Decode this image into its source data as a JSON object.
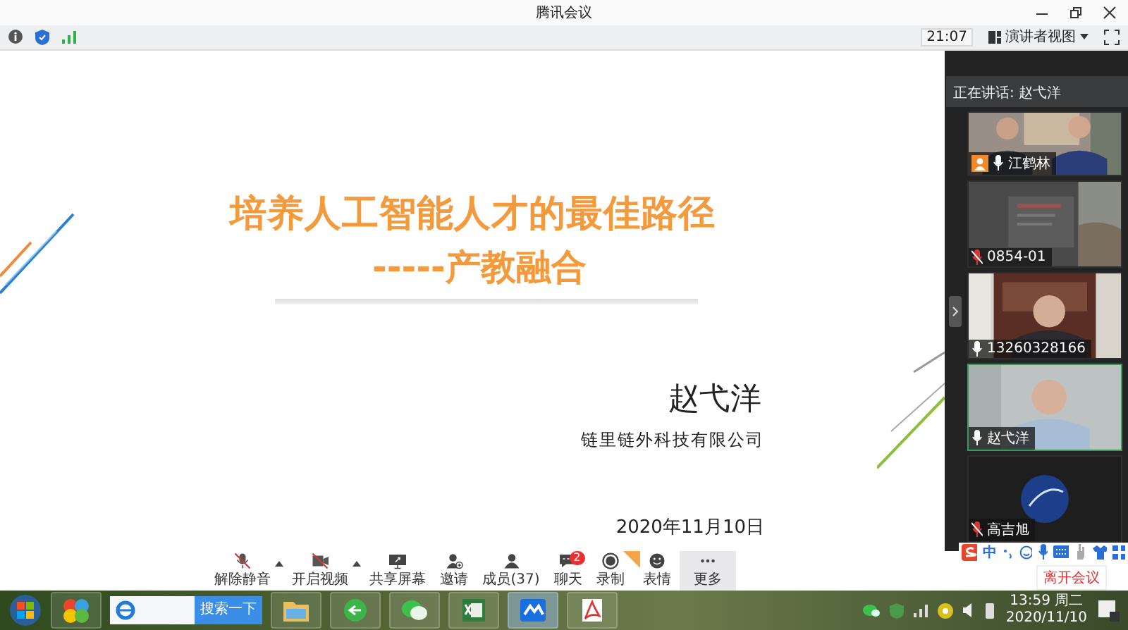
{
  "window": {
    "title": "腾讯会议"
  },
  "info_bar": {
    "time": "21:07",
    "view_mode": "演讲者视图"
  },
  "slide": {
    "title": "培养人工智能人才的最佳路径",
    "subtitle": "-----产教融合",
    "author": "赵弋洋",
    "company": "链里链外科技有限公司",
    "date": "2020年11月10日"
  },
  "speaker_panel": {
    "speaking": "正在讲话: 赵弋洋",
    "participants": [
      {
        "name": "江鹤林",
        "kind": "video",
        "host": true,
        "muted": false,
        "selected": false
      },
      {
        "name": "0854-01",
        "kind": "video",
        "host": false,
        "muted": true,
        "selected": false
      },
      {
        "name": "13260328166",
        "kind": "video",
        "host": false,
        "muted": false,
        "selected": false
      },
      {
        "name": "赵弋洋",
        "kind": "video",
        "host": false,
        "muted": false,
        "selected": true
      },
      {
        "name": "高吉旭",
        "kind": "avatar",
        "host": false,
        "muted": true,
        "selected": false
      }
    ]
  },
  "toolbar": [
    {
      "label": "解除静音",
      "kind": "mic",
      "off": true,
      "menu": true,
      "hovered": false,
      "corner_tag": false
    },
    {
      "label": "开启视频",
      "kind": "camera",
      "off": true,
      "menu": true,
      "hovered": false,
      "corner_tag": false
    },
    {
      "label": "共享屏幕",
      "kind": "share",
      "off": false,
      "menu": false,
      "hovered": false,
      "corner_tag": false
    },
    {
      "label": "邀请",
      "kind": "invite",
      "off": false,
      "menu": false,
      "hovered": false,
      "corner_tag": false
    },
    {
      "label": "成员(37)",
      "kind": "members",
      "off": false,
      "menu": false,
      "hovered": false,
      "corner_tag": false
    },
    {
      "label": "聊天",
      "kind": "chat",
      "off": false,
      "menu": false,
      "hovered": false,
      "corner_tag": false,
      "badge": "2"
    },
    {
      "label": "录制",
      "kind": "record",
      "off": false,
      "menu": false,
      "hovered": false,
      "corner_tag": true
    },
    {
      "label": "表情",
      "kind": "emoji",
      "off": false,
      "menu": false,
      "hovered": false,
      "corner_tag": false
    },
    {
      "label": "更多",
      "kind": "more",
      "off": false,
      "menu": false,
      "hovered": true,
      "corner_tag": false
    }
  ],
  "ime_bar": {
    "mode": "中"
  },
  "tooltip": "离开会议",
  "taskbar": {
    "apps": [
      {
        "kind": "start",
        "active": false
      },
      {
        "kind": "apps",
        "active": false
      },
      {
        "kind": "browser",
        "active": false,
        "search_button": "搜索一下"
      },
      {
        "kind": "folder",
        "active": false
      },
      {
        "kind": "launcher",
        "active": false
      },
      {
        "kind": "wechat",
        "active": false
      },
      {
        "kind": "spreadsheet",
        "active": false
      },
      {
        "kind": "meeting",
        "active": true
      },
      {
        "kind": "pdf",
        "active": false
      }
    ],
    "time": "13:59 周二",
    "date": "2020/11/10"
  }
}
